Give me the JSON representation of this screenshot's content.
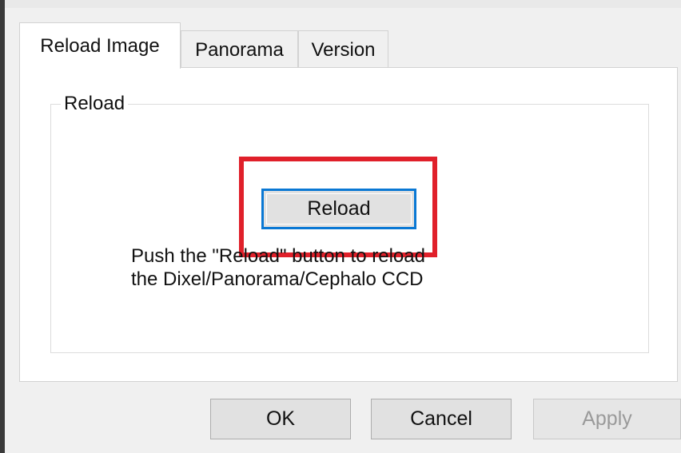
{
  "tabs": [
    {
      "label": "Reload Image",
      "active": true
    },
    {
      "label": "Panorama",
      "active": false
    },
    {
      "label": "Version",
      "active": false
    }
  ],
  "group": {
    "title": "Reload",
    "button_label": "Reload",
    "description_line1": "Push the \"Reload\" button to reload",
    "description_line2": "the Dixel/Panorama/Cephalo CCD"
  },
  "highlight_color": "#e0202a",
  "focus_color": "#0a78d4",
  "footer": {
    "ok_label": "OK",
    "cancel_label": "Cancel",
    "apply_label": "Apply",
    "apply_enabled": false
  }
}
